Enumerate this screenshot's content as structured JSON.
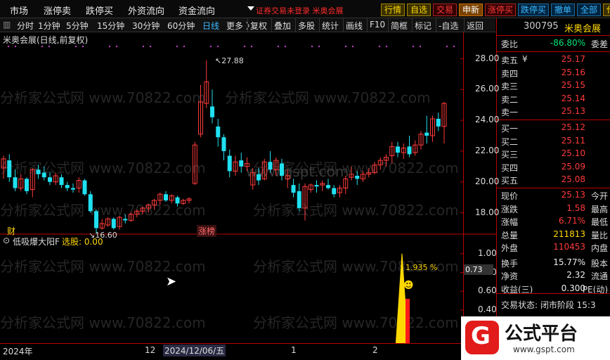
{
  "top_menu": [
    "市场",
    "涨停卖",
    "跌停买",
    "外资流向",
    "资金流向"
  ],
  "promo_text": "证券交易未登录  米奥会展",
  "top_buttons": [
    {
      "label": "行情",
      "style": "yellow"
    },
    {
      "label": "自选",
      "style": "yellow"
    },
    {
      "label": "交易",
      "style": "red"
    },
    {
      "label": "申新",
      "style": "orange"
    },
    {
      "label": "涨停买",
      "style": "red"
    },
    {
      "label": "跌停买",
      "style": "blue"
    },
    {
      "label": "撤单",
      "style": "blue"
    },
    {
      "label": "全部",
      "style": "blue"
    },
    {
      "label": "代码",
      "style": "yellow"
    }
  ],
  "toolbar": {
    "periods": [
      "分时",
      "1分钟",
      "5分钟",
      "15分钟",
      "30分钟",
      "60分钟",
      "日线",
      "更多 〉"
    ],
    "active_period": "日线",
    "tools": [
      "复权",
      "叠加",
      "多股",
      "统计",
      "画线",
      "F10",
      "简框",
      "标记",
      "-自选",
      "返回"
    ]
  },
  "chart_title": "米奥会展(日线,前复权)",
  "indicator_title": "低吸爆大阳F",
  "indicator_value": "选股: 0.00",
  "right": {
    "code": "300795",
    "name": "米奥会展",
    "weibi_label": "委比",
    "weibi": "-86.80%",
    "weicha_label": "委差",
    "asks": [
      {
        "l": "卖五",
        "p": "25.17",
        "v": "¥"
      },
      {
        "l": "卖四",
        "p": "25.16",
        "v": ""
      },
      {
        "l": "卖三",
        "p": "25.15",
        "v": ""
      },
      {
        "l": "卖二",
        "p": "25.14",
        "v": ""
      },
      {
        "l": "卖一",
        "p": "25.13",
        "v": ""
      }
    ],
    "bids": [
      {
        "l": "买一",
        "p": "25.12"
      },
      {
        "l": "买二",
        "p": "25.11"
      },
      {
        "l": "买三",
        "p": "25.10"
      },
      {
        "l": "买四",
        "p": "25.09"
      },
      {
        "l": "买五",
        "p": "25.08"
      }
    ],
    "stats": [
      {
        "l": "现价",
        "v": "25.13",
        "c": "red",
        "x": "今开"
      },
      {
        "l": "涨跌",
        "v": "1.58",
        "c": "red",
        "x": "最高"
      },
      {
        "l": "涨幅",
        "v": "6.71%",
        "c": "red",
        "x": "最低"
      },
      {
        "l": "总量",
        "v": "211813",
        "c": "yellow",
        "x": "量比"
      },
      {
        "l": "外盘",
        "v": "110453",
        "c": "red",
        "x": "内盘"
      },
      {
        "l": "换手",
        "v": "15.77%",
        "c": "white",
        "x": "股本"
      },
      {
        "l": "净资",
        "v": "2.32",
        "c": "white",
        "x": "流通"
      },
      {
        "l": "收益(三)",
        "v": "0.300",
        "c": "white",
        "x": "PE(动)"
      }
    ],
    "status": "交易状态: 闭市阶段 15:3"
  },
  "price_axis": [
    "28.00",
    "26.00",
    "24.00",
    "22.00",
    "20.00",
    "18.00"
  ],
  "ind_axis": [
    "1.00",
    "0.80",
    "0.60",
    "0.40"
  ],
  "ind_current": "0.73",
  "high_label": "27.88",
  "low_label": "16.60",
  "pct_label": "1.935 %",
  "marker_cai": "财",
  "marker_zb": "涨榜",
  "time_axis": [
    "2024年",
    "12",
    "2024/12/06/五",
    "1",
    "2"
  ],
  "logo_text": "公式平台",
  "logo_url": "www.gspt.com",
  "watermark": "分析家公式网 www.70822.com",
  "watermark2": "www.gspt.com",
  "candles": [
    [
      20.9,
      21.7,
      20.2,
      21.5
    ],
    [
      21.4,
      21.8,
      20.0,
      20.3
    ],
    [
      20.3,
      20.8,
      19.4,
      19.6
    ],
    [
      19.6,
      20.5,
      19.4,
      20.2
    ],
    [
      20.2,
      20.3,
      19.2,
      19.4
    ],
    [
      19.5,
      20.9,
      19.0,
      20.8
    ],
    [
      20.8,
      21.1,
      20.2,
      20.5
    ],
    [
      20.6,
      21.0,
      20.1,
      20.3
    ],
    [
      20.3,
      20.6,
      19.8,
      20.0
    ],
    [
      20.0,
      20.6,
      19.8,
      20.4
    ],
    [
      20.3,
      20.5,
      19.6,
      19.8
    ],
    [
      19.8,
      20.0,
      19.4,
      19.6
    ],
    [
      19.6,
      19.9,
      19.3,
      19.5
    ],
    [
      19.6,
      20.3,
      19.3,
      20.1
    ],
    [
      20.1,
      20.2,
      19.1,
      19.2
    ],
    [
      19.2,
      19.4,
      18.0,
      18.1
    ],
    [
      18.1,
      18.2,
      16.6,
      17.0
    ],
    [
      17.0,
      17.6,
      16.9,
      17.3
    ],
    [
      17.2,
      17.7,
      17.1,
      17.6
    ],
    [
      17.6,
      17.7,
      16.9,
      17.0
    ],
    [
      17.1,
      17.8,
      16.9,
      17.7
    ],
    [
      17.6,
      17.9,
      17.3,
      17.5
    ],
    [
      17.5,
      18.0,
      17.4,
      17.9
    ],
    [
      17.9,
      18.2,
      17.7,
      18.1
    ],
    [
      18.1,
      18.4,
      17.9,
      18.3
    ],
    [
      18.3,
      18.6,
      18.0,
      18.5
    ],
    [
      18.5,
      18.9,
      18.2,
      18.8
    ],
    [
      18.8,
      19.3,
      18.5,
      19.2
    ],
    [
      19.2,
      19.4,
      18.7,
      18.8
    ],
    [
      18.8,
      19.2,
      18.6,
      19.1
    ],
    [
      19.0,
      19.1,
      18.4,
      18.6
    ],
    [
      18.6,
      18.9,
      18.5,
      18.8
    ],
    [
      18.8,
      19.0,
      18.6,
      18.9
    ],
    [
      19.9,
      22.6,
      19.8,
      22.4
    ],
    [
      23.1,
      26.3,
      22.9,
      25.2
    ],
    [
      25.1,
      27.9,
      24.8,
      26.5
    ],
    [
      24.9,
      26.0,
      23.8,
      24.2
    ],
    [
      23.6,
      24.1,
      22.3,
      22.9
    ],
    [
      22.9,
      23.1,
      21.4,
      22.0
    ],
    [
      21.7,
      22.1,
      20.3,
      20.7
    ],
    [
      20.7,
      21.7,
      20.4,
      21.3
    ],
    [
      21.4,
      21.9,
      20.6,
      21.0
    ],
    [
      21.0,
      21.6,
      20.7,
      21.2
    ],
    [
      19.8,
      20.9,
      19.5,
      20.6
    ],
    [
      20.5,
      20.9,
      19.8,
      20.1
    ],
    [
      20.2,
      21.5,
      20.1,
      21.3
    ],
    [
      21.3,
      22.0,
      20.6,
      20.8
    ],
    [
      20.8,
      21.6,
      20.4,
      21.4
    ],
    [
      21.2,
      21.5,
      20.1,
      20.4
    ],
    [
      20.2,
      20.8,
      19.6,
      20.4
    ],
    [
      19.8,
      20.2,
      19.0,
      19.3
    ],
    [
      19.4,
      19.9,
      18.1,
      18.3
    ],
    [
      18.3,
      19.9,
      17.5,
      19.7
    ],
    [
      19.5,
      19.9,
      19.3,
      19.8
    ],
    [
      19.8,
      20.1,
      19.3,
      19.7
    ],
    [
      19.8,
      20.1,
      19.4,
      19.9
    ],
    [
      19.8,
      20.2,
      19.5,
      19.6
    ],
    [
      19.6,
      19.8,
      19.0,
      19.2
    ],
    [
      19.3,
      19.8,
      19.0,
      19.6
    ],
    [
      19.6,
      20.4,
      19.2,
      20.2
    ],
    [
      20.3,
      21.0,
      20.1,
      20.5
    ],
    [
      20.4,
      20.7,
      19.8,
      20.2
    ],
    [
      20.2,
      20.7,
      20.0,
      20.5
    ],
    [
      20.5,
      20.9,
      20.3,
      20.6
    ],
    [
      20.6,
      21.3,
      20.5,
      21.1
    ],
    [
      21.1,
      21.6,
      20.8,
      21.4
    ],
    [
      21.4,
      21.8,
      21.0,
      21.6
    ],
    [
      21.7,
      22.6,
      21.2,
      22.3
    ],
    [
      22.3,
      22.6,
      21.6,
      21.9
    ],
    [
      21.9,
      22.5,
      21.5,
      22.2
    ],
    [
      22.3,
      23.0,
      21.6,
      21.8
    ],
    [
      21.9,
      22.7,
      21.7,
      22.4
    ],
    [
      22.4,
      23.3,
      22.1,
      23.1
    ],
    [
      23.2,
      24.3,
      22.5,
      23.0
    ],
    [
      23.0,
      24.3,
      22.6,
      24.1
    ],
    [
      24.1,
      24.5,
      23.3,
      23.6
    ],
    [
      23.6,
      25.2,
      22.5,
      25.1
    ]
  ],
  "indicator": {
    "spike_value": 1.0,
    "bar_value": 0.52
  }
}
